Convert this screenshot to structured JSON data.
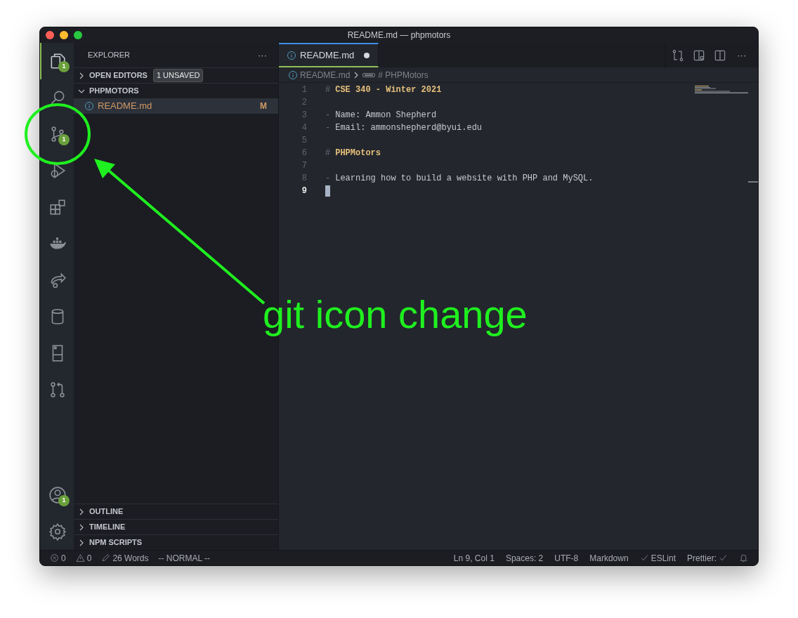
{
  "window": {
    "title": "README.md — phpmotors"
  },
  "activity_bar": {
    "top": [
      {
        "kind": "files",
        "selected": true,
        "badge": "1"
      },
      {
        "kind": "search",
        "selected": false
      },
      {
        "kind": "source-control",
        "selected": false,
        "badge": "1"
      },
      {
        "kind": "debug",
        "selected": false
      },
      {
        "kind": "extensions",
        "selected": false
      },
      {
        "kind": "docker",
        "selected": false
      },
      {
        "kind": "share",
        "selected": false
      },
      {
        "kind": "database",
        "selected": false
      },
      {
        "kind": "panel",
        "selected": false
      },
      {
        "kind": "pull-request",
        "selected": false
      }
    ],
    "bottom": [
      {
        "kind": "account",
        "selected": false,
        "badge": "1"
      },
      {
        "kind": "gear",
        "selected": false
      }
    ]
  },
  "sidebar": {
    "title": "EXPLORER",
    "more": "···",
    "sections": [
      {
        "label": "OPEN EDITORS",
        "expanded": false,
        "badge": "1 UNSAVED"
      },
      {
        "label": "PHPMOTORS",
        "expanded": true,
        "files": [
          {
            "name": "README.md",
            "status": "M",
            "selected": true
          }
        ]
      }
    ],
    "bottom_sections": [
      {
        "label": "OUTLINE",
        "expanded": false
      },
      {
        "label": "TIMELINE",
        "expanded": false
      },
      {
        "label": "NPM SCRIPTS",
        "expanded": false
      }
    ]
  },
  "editor": {
    "tabs": [
      {
        "label": "README.md",
        "selected": true,
        "modified": true
      }
    ],
    "actions": [
      {
        "kind": "compare"
      },
      {
        "kind": "preview"
      },
      {
        "kind": "split"
      },
      {
        "kind": "more",
        "text": "···"
      }
    ],
    "breadcrumb": [
      "README.md",
      "# PHPMotors"
    ],
    "lines": [
      {
        "number": "1",
        "current": false,
        "segments": [
          {
            "kind": "mark",
            "text": "#"
          },
          {
            "kind": "heading",
            "text": "CSE 340 - Winter 2021"
          }
        ]
      },
      {
        "number": "2",
        "current": false
      },
      {
        "number": "3",
        "current": false,
        "segments": [
          {
            "kind": "mark",
            "text": "-"
          },
          {
            "kind": "text",
            "text": "Name: Ammon Shepherd"
          }
        ]
      },
      {
        "number": "4",
        "current": false,
        "segments": [
          {
            "kind": "mark",
            "text": "-"
          },
          {
            "kind": "text",
            "text": "Email: ammonshepherd@byui.edu"
          }
        ]
      },
      {
        "number": "5",
        "current": false
      },
      {
        "number": "6",
        "current": false,
        "segments": [
          {
            "kind": "mark",
            "text": "#"
          },
          {
            "kind": "heading",
            "text": "PHPMotors"
          }
        ]
      },
      {
        "number": "7",
        "current": false
      },
      {
        "number": "8",
        "current": false,
        "segments": [
          {
            "kind": "mark",
            "text": "-"
          },
          {
            "kind": "text",
            "text": "Learning how to build a website with PHP and MySQL."
          }
        ]
      },
      {
        "number": "9",
        "current": true
      }
    ]
  },
  "status_bar": {
    "left": [
      {
        "kind": "errors",
        "text": "0"
      },
      {
        "kind": "warnings",
        "text": "0"
      },
      {
        "kind": "words",
        "text": "26 Words"
      },
      {
        "kind": "plain",
        "text": "-- NORMAL --"
      }
    ],
    "right": [
      {
        "kind": "plain",
        "text": "Ln 9, Col 1"
      },
      {
        "kind": "plain",
        "text": "Spaces: 2"
      },
      {
        "kind": "plain",
        "text": "UTF-8"
      },
      {
        "kind": "plain",
        "text": "Markdown"
      },
      {
        "kind": "lint",
        "text": "ESLint"
      },
      {
        "kind": "formatter",
        "text": "Prettier:"
      },
      {
        "kind": "notifications"
      }
    ]
  },
  "annotation": {
    "text": "git icon change"
  }
}
